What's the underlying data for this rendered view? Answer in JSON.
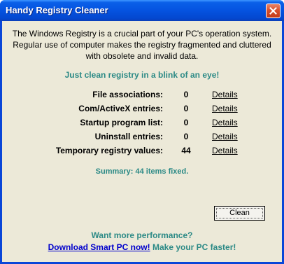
{
  "window": {
    "title": "Handy Registry Cleaner",
    "close_icon": "close-icon"
  },
  "intro": "The Windows Registry is a crucial part of your PC's operation system. Regular use of computer makes the registry fragmented and cluttered with obsolete and invalid data.",
  "tagline": "Just clean registry in a blink of an eye!",
  "rows": [
    {
      "label": "File associations:",
      "value": "0",
      "link": "Details"
    },
    {
      "label": "Com/ActiveX entries:",
      "value": "0",
      "link": "Details"
    },
    {
      "label": "Startup program list:",
      "value": "0",
      "link": "Details"
    },
    {
      "label": "Uninstall entries:",
      "value": "0",
      "link": "Details"
    },
    {
      "label": "Temporary registry values:",
      "value": "44",
      "link": "Details"
    }
  ],
  "summary": "Summary:  44 items fixed.",
  "clean_label": "Clean",
  "more": "Want more performance?",
  "download_link": "Download Smart PC now!",
  "faster": "Make your PC faster!",
  "colors": {
    "titlebar": "#0553e0",
    "client_bg": "#ece9d8",
    "teal_text": "#2c8a86",
    "link_blue": "#0000cc"
  }
}
